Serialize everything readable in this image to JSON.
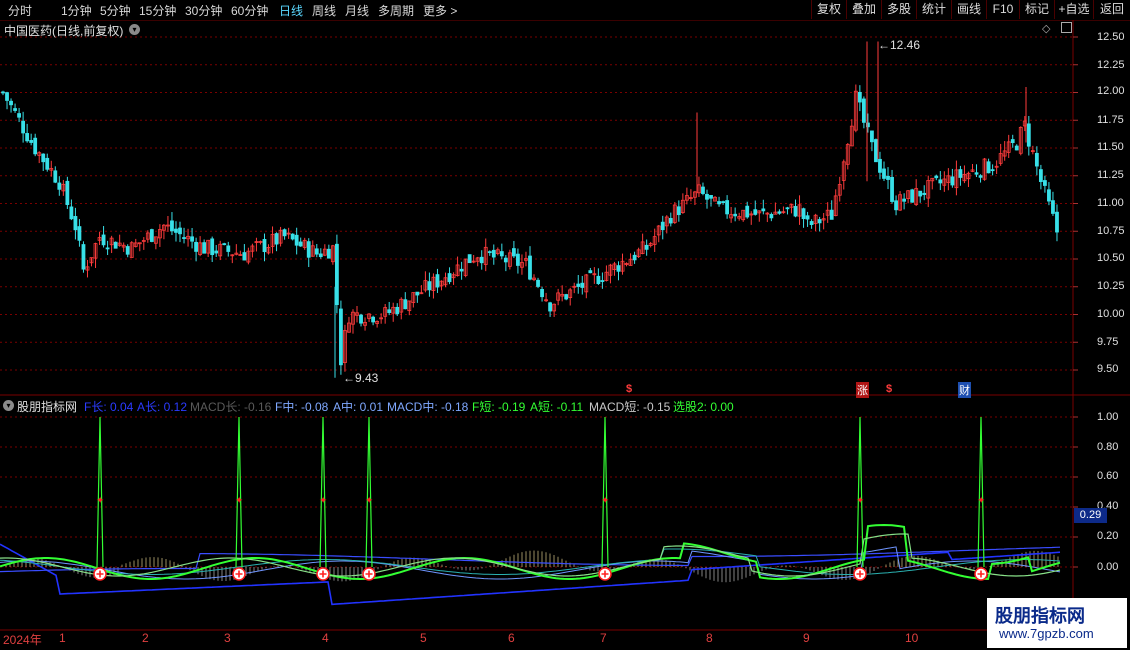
{
  "toolbar": {
    "periods": [
      "分时",
      "1分钟",
      "5分钟",
      "15分钟",
      "30分钟",
      "60分钟",
      "日线",
      "周线",
      "月线",
      "多周期",
      "更多"
    ],
    "active_period": "日线",
    "more_chevron": "chevron-right-icon",
    "tools": [
      "复权",
      "叠加",
      "多股",
      "统计",
      "画线",
      "F10",
      "标记",
      "+自选",
      "返回"
    ]
  },
  "main": {
    "title": "中国医药(日线,前复权)",
    "high_label": "12.46",
    "low_label": "9.43",
    "price_axis": [
      "12.50",
      "12.25",
      "12.00",
      "11.75",
      "11.50",
      "11.25",
      "11.00",
      "10.75",
      "10.50",
      "10.25",
      "10.00",
      "9.75",
      "9.50"
    ],
    "event_marks": [
      "$",
      "涨",
      "$",
      "财"
    ]
  },
  "indicator": {
    "name": "股朋指标网",
    "legend": [
      {
        "text": "F长: 0.04",
        "color": "#2b3bff"
      },
      {
        "text": "A长: 0.12",
        "color": "#2b3bff"
      },
      {
        "text": "MACD长: -0.16",
        "color": "#5a5a5a"
      },
      {
        "text": "F中: -0.08",
        "color": "#7fa8ff"
      },
      {
        "text": "A中: 0.01",
        "color": "#7fa8ff"
      },
      {
        "text": "MACD中: -0.18",
        "color": "#7fa8ff"
      },
      {
        "text": "F短: -0.19",
        "color": "#33ff33"
      },
      {
        "text": "A短: -0.11",
        "color": "#33ff33"
      },
      {
        "text": "MACD短: -0.15",
        "color": "#c8c8c8"
      },
      {
        "text": "选股2: 0.00",
        "color": "#33ff33"
      }
    ],
    "axis": [
      "1.00",
      "0.80",
      "0.60",
      "0.40",
      "0.20",
      "0.00"
    ],
    "current_value": "0.29"
  },
  "time_axis": [
    "2024年",
    "1",
    "2",
    "3",
    "4",
    "5",
    "6",
    "7",
    "8",
    "9",
    "10"
  ],
  "watermark": {
    "title": "股朋指标网",
    "url": "www.7gpzb.com"
  },
  "colors": {
    "up": "#ff3c3c",
    "down": "#38e0e8",
    "grid": "#7a0000",
    "green": "#33ff33",
    "blue": "#2233ff"
  }
}
